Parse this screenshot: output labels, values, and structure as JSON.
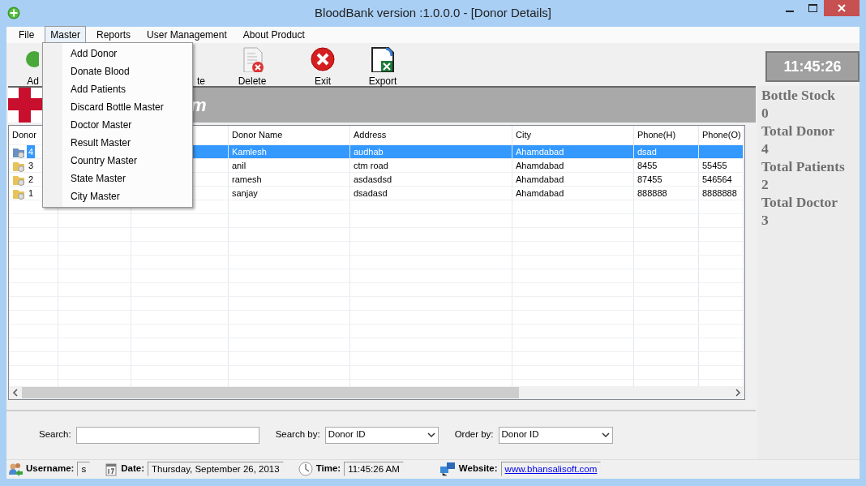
{
  "window": {
    "title": "BloodBank version :1.0.0.0 - [Donor Details]"
  },
  "menu_bar": [
    {
      "label": "File",
      "selected": false
    },
    {
      "label": "Master",
      "selected": true
    },
    {
      "label": "Reports",
      "selected": false
    },
    {
      "label": "User Management",
      "selected": false
    },
    {
      "label": "About Product",
      "selected": false
    }
  ],
  "open_menu": {
    "items": [
      "Add Donor",
      "Donate Blood",
      "Add Patients",
      "Discard Bottle Master",
      "Doctor Master",
      "Result Master",
      "Country Master",
      "State Master",
      "City Master"
    ]
  },
  "toolbar": [
    {
      "label": "Ad",
      "kind": "add"
    },
    {
      "label": "te",
      "kind": "edit"
    },
    {
      "label": "Delete",
      "kind": "delete"
    },
    {
      "label": "Exit",
      "kind": "exit"
    },
    {
      "label": "Export",
      "kind": "export"
    }
  ],
  "clock": "11:45:26",
  "banner": {
    "title": "m"
  },
  "table": {
    "columns": [
      "Donor",
      null,
      null,
      "Donor Name",
      "Address",
      "City",
      "Phone(H)",
      "Phone(O)"
    ],
    "rows": [
      {
        "selected": true,
        "cells": [
          "4",
          null,
          null,
          "Kamlesh",
          "audhab",
          "Ahamdabad",
          "dsad",
          null
        ]
      },
      {
        "selected": false,
        "cells": [
          "3",
          null,
          null,
          "anil",
          "ctm road",
          "Ahamdabad",
          "8455",
          "55455"
        ]
      },
      {
        "selected": false,
        "cells": [
          "2",
          null,
          null,
          "ramesh",
          "asdasdsd",
          "Ahamdabad",
          "87455",
          "546564"
        ]
      },
      {
        "selected": false,
        "cells": [
          "1",
          null,
          null,
          "sanjay",
          "dsadasd",
          "Ahamdabad",
          "888888",
          "8888888"
        ]
      }
    ]
  },
  "stats": [
    {
      "label": "Bottle Stock",
      "value": "0"
    },
    {
      "label": "Total Donor",
      "value": "4"
    },
    {
      "label": "Total Patients",
      "value": "2"
    },
    {
      "label": "Total Doctor",
      "value": "3"
    }
  ],
  "search": {
    "label": "Search:",
    "search_by_label": "Search by:",
    "search_by": "Donor ID",
    "order_by_label": "Order by:",
    "order_by": "Donor ID"
  },
  "status_bar": {
    "username_label": "Username:",
    "username": "s",
    "date_label": "Date:",
    "date": "Thursday, September 26, 2013",
    "time_label": "Time:",
    "time": "11:45:26 AM",
    "website_label": "Website:",
    "website": "www.bhansalisoft.com"
  }
}
